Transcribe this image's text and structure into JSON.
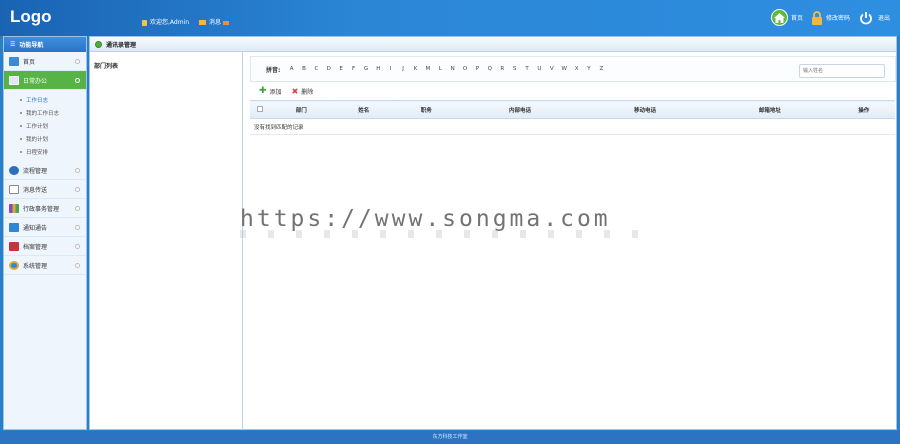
{
  "header": {
    "logo": "Logo",
    "welcome": "欢迎您,Admin",
    "messages": "消息",
    "nav": {
      "home": "首页",
      "change_password": "修改密码",
      "logout": "退出"
    }
  },
  "sidebar": {
    "title": "功能导航",
    "items": [
      {
        "label": "首页",
        "icon": "monitor-icon"
      },
      {
        "label": "日常办公",
        "icon": "calendar-icon",
        "active": true
      },
      {
        "label": "流程管理",
        "icon": "flow-icon"
      },
      {
        "label": "消息传送",
        "icon": "envelope-icon"
      },
      {
        "label": "行政事务管理",
        "icon": "chart-icon"
      },
      {
        "label": "通知通告",
        "icon": "notice-icon"
      },
      {
        "label": "档案管理",
        "icon": "book-icon"
      },
      {
        "label": "系统管理",
        "icon": "settings-icon"
      }
    ],
    "sub_items": [
      "工作日志",
      "我的工作日志",
      "工作计划",
      "我的计划",
      "日程安排"
    ]
  },
  "main": {
    "title": "通讯录管理",
    "dept_title": "部门列表",
    "pinyin_label": "拼音:",
    "letters": [
      "A",
      "B",
      "C",
      "D",
      "E",
      "F",
      "G",
      "H",
      "I",
      "J",
      "K",
      "M",
      "L",
      "N",
      "O",
      "P",
      "Q",
      "R",
      "S",
      "T",
      "U",
      "V",
      "W",
      "X",
      "Y",
      "Z"
    ],
    "search_placeholder": "输入姓名",
    "toolbar": {
      "add": "添加",
      "delete": "删除"
    },
    "columns": [
      "部门",
      "姓名",
      "职务",
      "内部电话",
      "移动电话",
      "邮箱地址",
      "操作"
    ],
    "empty_text": "没有找到匹配的记录"
  },
  "watermark": "https://www.songma.com",
  "footer": "东方科技工作室",
  "colors": {
    "header": "#2b86d6",
    "active": "#58b346",
    "footer": "#2c74c2"
  }
}
